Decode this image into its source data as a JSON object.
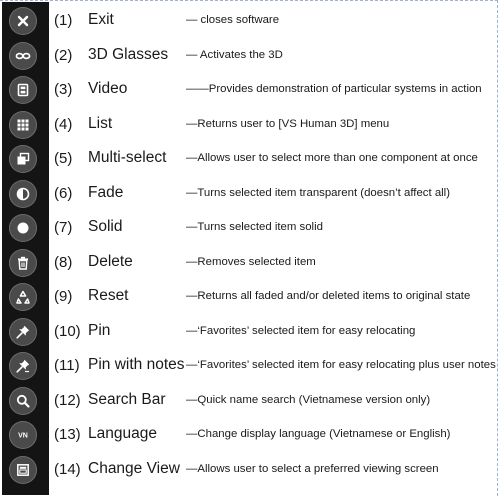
{
  "items": [
    {
      "num": "(1)",
      "name": "Exit",
      "icon": "close-icon",
      "desc": "— closes software"
    },
    {
      "num": "(2)",
      "name": "3D  Glasses",
      "icon": "glasses-icon",
      "desc": "— Activates the 3D"
    },
    {
      "num": "(3)",
      "name": "Video",
      "icon": "film-icon",
      "desc": "——Provides demonstration of particular systems in action"
    },
    {
      "num": "(4)",
      "name": "List",
      "icon": "grid-icon",
      "desc": "—Returns user to [VS  Human 3D] menu"
    },
    {
      "num": "(5)",
      "name": "Multi-select",
      "icon": "stacked-squares-icon",
      "desc": "—Allows user to select more than one component at once"
    },
    {
      "num": "(6)",
      "name": "Fade",
      "icon": "half-circle-icon",
      "desc": "—Turns selected item  transparent  (doesn’t affect all)"
    },
    {
      "num": "(7)",
      "name": "Solid",
      "icon": "solid-circle-icon",
      "desc": "—Turns selected item solid"
    },
    {
      "num": "(8)",
      "name": "Delete",
      "icon": "trash-icon",
      "desc": "—Removes selected item"
    },
    {
      "num": "(9)",
      "name": "Reset",
      "icon": "recycle-icon",
      "desc": "—Returns all faded and/or deleted items to original state"
    },
    {
      "num": "(10)",
      "name": "Pin",
      "icon": "pin-icon",
      "desc": "—‘Favorites’ selected item for easy relocating"
    },
    {
      "num": "(11)",
      "name": "Pin with notes",
      "icon": "pin-notes-icon",
      "desc": "—‘Favorites’ selected item for easy relocating plus user notes"
    },
    {
      "num": "(12)",
      "name": "Search Bar",
      "icon": "search-icon",
      "desc": "—Quick name search (Vietnamese version only)"
    },
    {
      "num": "(13)",
      "name": "Language",
      "icon": "vn-language-icon",
      "desc": "—Change display language (Vietnamese or English)"
    },
    {
      "num": "(14)",
      "name": "Change View",
      "icon": "view-screen-icon",
      "desc": "—Allows user to select a preferred viewing screen"
    }
  ],
  "icon_labels": {
    "language": "VN"
  },
  "colors": {
    "toolbar_bg": "#141414",
    "button_bg": "#4a4a4a",
    "icon_fg": "#ffffff",
    "text": "#1a1a1a"
  }
}
